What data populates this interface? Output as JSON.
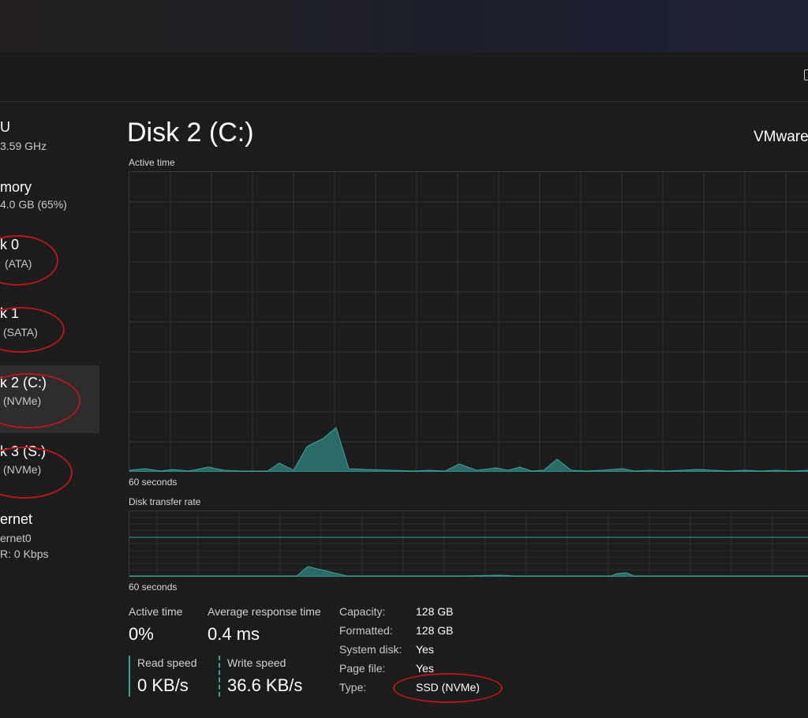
{
  "sidebar": {
    "items": [
      {
        "title": "U",
        "sub": "3.59 GHz",
        "sub2": ""
      },
      {
        "title": "mory",
        "sub": "4.0 GB (65%)",
        "sub2": ""
      },
      {
        "title": "k 0",
        "sub": "(ATA)",
        "sub2": ""
      },
      {
        "title": "k 1",
        "sub": "(SATA)",
        "sub2": ""
      },
      {
        "title": "k 2 (C:)",
        "sub": "(NVMe)",
        "sub2": ""
      },
      {
        "title": "k 3 (S:)",
        "sub": "(NVMe)",
        "sub2": ""
      },
      {
        "title": "ernet",
        "sub": "ernet0",
        "sub2": "R: 0 Kbps"
      }
    ]
  },
  "main": {
    "title": "Disk 2 (C:)",
    "model": "VMware",
    "active_time_graph": {
      "label": "Active time",
      "duration_label": "60 seconds"
    },
    "transfer_graph": {
      "label": "Disk transfer rate",
      "duration_label": "60 seconds"
    }
  },
  "stats": {
    "active_time": {
      "label": "Active time",
      "value": "0%"
    },
    "avg_response": {
      "label": "Average response time",
      "value": "0.4 ms"
    },
    "read_speed": {
      "label": "Read speed",
      "value": "0 KB/s"
    },
    "write_speed": {
      "label": "Write speed",
      "value": "36.6 KB/s"
    }
  },
  "properties": [
    {
      "label": "Capacity:",
      "value": "128 GB"
    },
    {
      "label": "Formatted:",
      "value": "128 GB"
    },
    {
      "label": "System disk:",
      "value": "Yes"
    },
    {
      "label": "Page file:",
      "value": "Yes"
    },
    {
      "label": "Type:",
      "value": "SSD (NVMe)"
    }
  ],
  "colors": {
    "accent": "#3aa39c",
    "fill": "#2a6b68",
    "annotation": "#b3161c",
    "background": "#1c1c1c"
  },
  "icons": {
    "toolbar": "window-icon"
  }
}
